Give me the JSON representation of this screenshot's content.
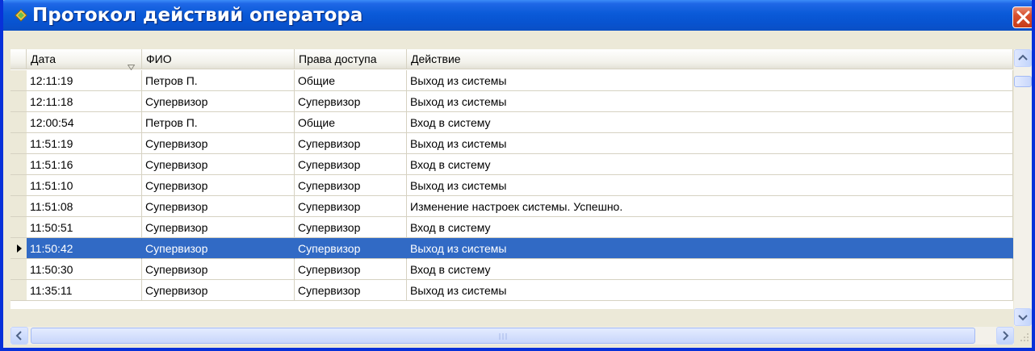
{
  "window": {
    "title": "Протокол действий оператора",
    "accent": "#0a5ad8",
    "icons": {
      "title": "diamond-app-icon",
      "close": "close-icon"
    }
  },
  "table": {
    "columns": [
      "Дата",
      "ФИО",
      "Права доступа",
      "Действие"
    ],
    "sorted_column": "Дата",
    "sort_icon": "sort-triangle-icon",
    "selected_row": 8,
    "selected_color": "#316ac5",
    "rows": [
      [
        "12:11:19",
        "Петров П.",
        "Общие",
        "Выход из системы"
      ],
      [
        "12:11:18",
        "Супервизор",
        "Супервизор",
        "Выход из системы"
      ],
      [
        "12:00:54",
        "Петров П.",
        "Общие",
        "Вход в систему"
      ],
      [
        "11:51:19",
        "Супервизор",
        "Супервизор",
        "Выход из системы"
      ],
      [
        "11:51:16",
        "Супервизор",
        "Супервизор",
        "Вход в систему"
      ],
      [
        "11:51:10",
        "Супервизор",
        "Супервизор",
        "Выход из системы"
      ],
      [
        "11:51:08",
        "Супервизор",
        "Супервизор",
        "Изменение настроек системы. Успешно."
      ],
      [
        "11:50:51",
        "Супервизор",
        "Супервизор",
        "Вход в систему"
      ],
      [
        "11:50:42",
        "Супервизор",
        "Супервизор",
        "Выход из системы"
      ],
      [
        "11:50:30",
        "Супервизор",
        "Супервизор",
        "Вход в систему"
      ],
      [
        "11:35:11",
        "Супервизор",
        "Супервизор",
        "Выход из системы"
      ]
    ]
  }
}
